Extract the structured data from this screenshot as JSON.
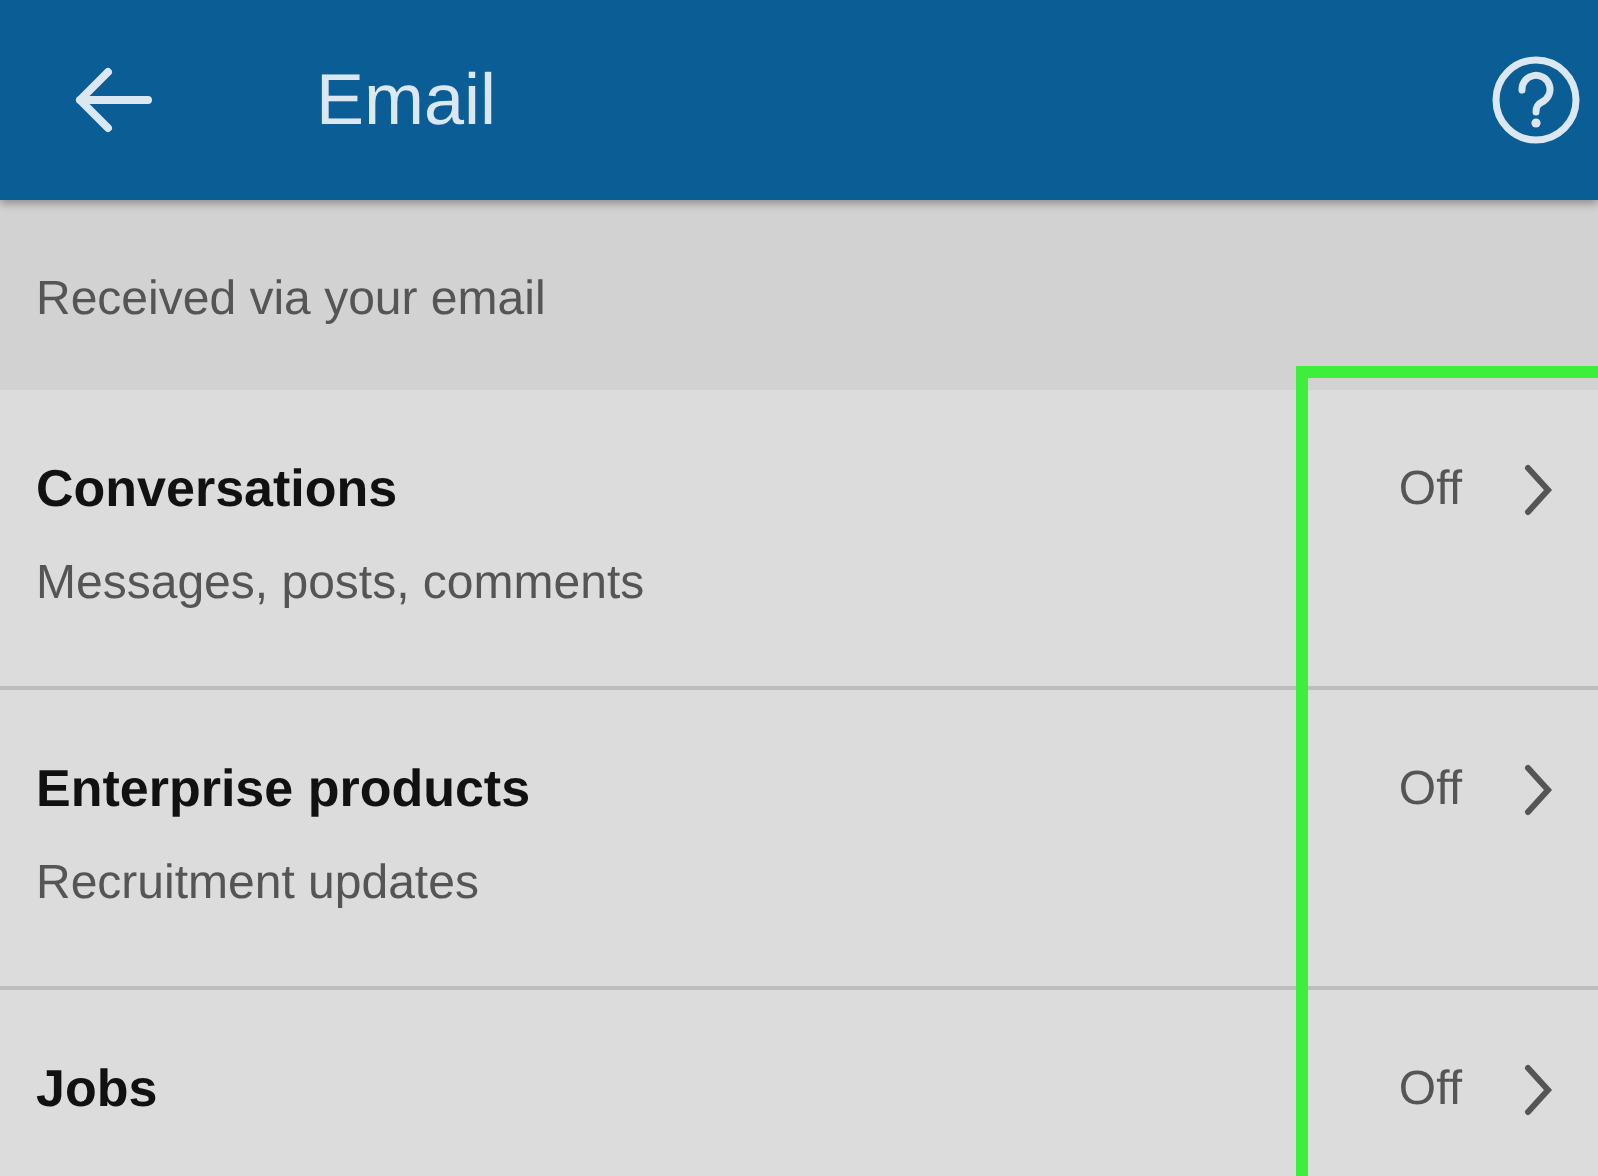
{
  "app_bar": {
    "title": "Email"
  },
  "section": {
    "label": "Received via your email"
  },
  "rows": [
    {
      "title": "Conversations",
      "subtitle": "Messages, posts, comments",
      "value": "Off"
    },
    {
      "title": "Enterprise products",
      "subtitle": "Recruitment updates",
      "value": "Off"
    },
    {
      "title": "Jobs",
      "value": "Off"
    }
  ]
}
